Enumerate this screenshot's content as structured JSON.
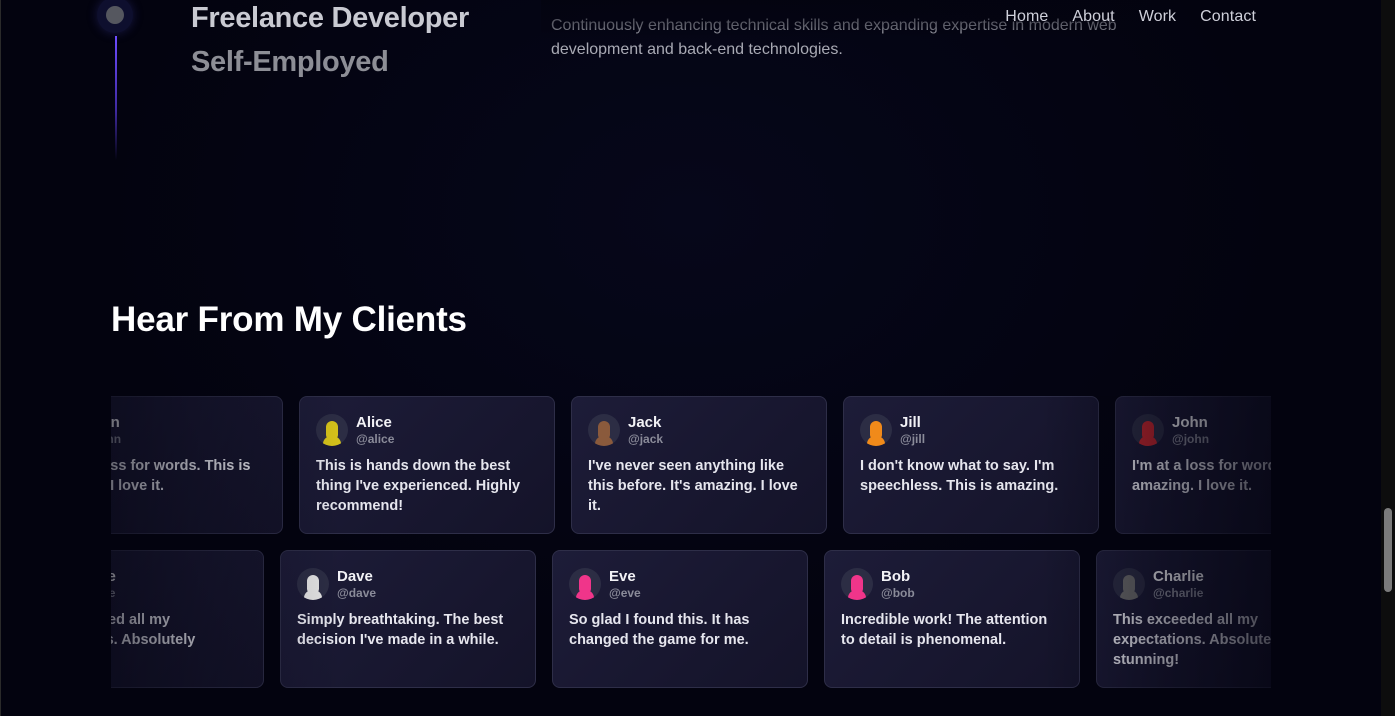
{
  "nav": {
    "links": [
      "Home",
      "About",
      "Work",
      "Contact"
    ]
  },
  "experience": {
    "title": "Freelance Developer",
    "company": "Self-Employed",
    "description": "Continuously enhancing technical skills and expanding expertise in modern web development and back-end technologies."
  },
  "testimonials": {
    "heading": "Hear From My Clients",
    "row1": [
      {
        "name": "John",
        "handle": "@john",
        "text": "I'm at a loss for words. This is amazing. I love it.",
        "avatar_color": "#c0262e"
      },
      {
        "name": "Alice",
        "handle": "@alice",
        "text": "This is hands down the best thing I've experienced. Highly recommend!",
        "avatar_color": "#d4c21a"
      },
      {
        "name": "Jack",
        "handle": "@jack",
        "text": "I've never seen anything like this before. It's amazing. I love it.",
        "avatar_color": "#8a5a3c"
      },
      {
        "name": "Jill",
        "handle": "@jill",
        "text": "I don't know what to say. I'm speechless. This is amazing.",
        "avatar_color": "#f08a1a"
      },
      {
        "name": "John",
        "handle": "@john",
        "text": "I'm at a loss for words. This is amazing. I love it.",
        "avatar_color": "#c0262e"
      }
    ],
    "row2": [
      {
        "name": "Charlie",
        "handle": "@charlie",
        "text": "This exceeded all my expectations. Absolutely stunning!",
        "avatar_color": "#6b6b6b"
      },
      {
        "name": "Dave",
        "handle": "@dave",
        "text": "Simply breathtaking. The best decision I've made in a while.",
        "avatar_color": "#e4e4e4"
      },
      {
        "name": "Eve",
        "handle": "@eve",
        "text": "So glad I found this. It has changed the game for me.",
        "avatar_color": "#f0358a"
      },
      {
        "name": "Bob",
        "handle": "@bob",
        "text": "Incredible work! The attention to detail is phenomenal.",
        "avatar_color": "#f0358a"
      },
      {
        "name": "Charlie",
        "handle": "@charlie",
        "text": "This exceeded all my expectations. Absolutely stunning!",
        "avatar_color": "#6b6b6b"
      }
    ]
  },
  "icons": {
    "timeline": "timeline-dot-icon",
    "avatar": "user-avatar-icon"
  },
  "colors": {
    "background": "#03030f",
    "card": "#1d1c38",
    "accent": "#6d4cff"
  }
}
